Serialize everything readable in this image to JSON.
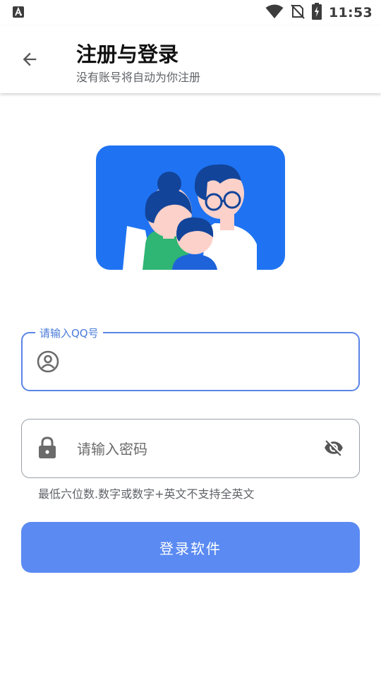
{
  "status_bar": {
    "time": "11:53",
    "icons": [
      "notification-a-icon",
      "wifi-icon",
      "no-sim-icon",
      "battery-charging-icon"
    ]
  },
  "header": {
    "title": "注册与登录",
    "subtitle": "没有账号将自动为你注册",
    "back_icon": "arrow-left-icon"
  },
  "illustration": {
    "name": "family-illustration",
    "colors": {
      "background": "#1f73f2",
      "dark_blue": "#12449a",
      "skin": "#fcd1c9",
      "green": "#2fb574",
      "white": "#ffffff"
    }
  },
  "qq_field": {
    "label": "请输入QQ号",
    "value": "",
    "icon": "account-circle-icon"
  },
  "password_field": {
    "placeholder": "请输入密码",
    "value": "",
    "icon": "lock-icon",
    "toggle_icon": "eye-off-icon"
  },
  "hint": "最低六位数.数字或数字+英文不支持全英文",
  "login_button": {
    "label": "登录软件",
    "color": "#5a8af2"
  },
  "accent_color": "#5a85e6"
}
